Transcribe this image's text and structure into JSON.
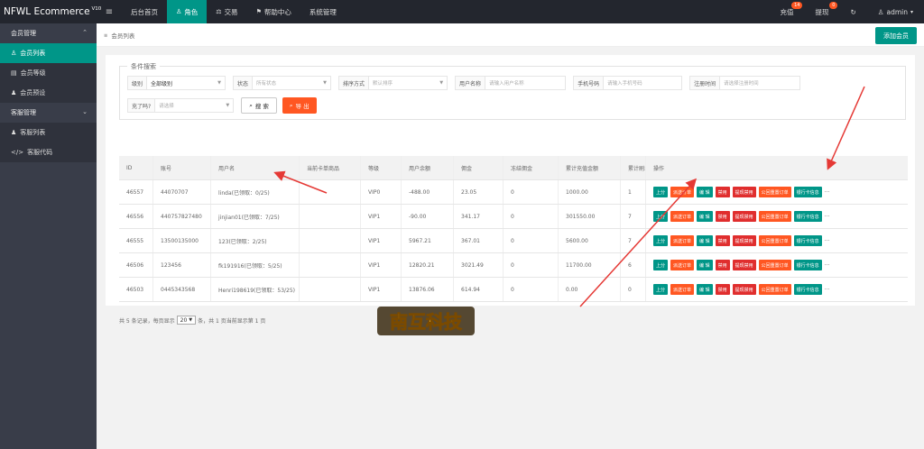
{
  "topbar": {
    "brand": "NFWL Ecommerce",
    "brand_version": "V10",
    "nav": [
      {
        "label": "后台首页",
        "icon": ""
      },
      {
        "label": "角色",
        "icon": "person-icon"
      },
      {
        "label": "交易",
        "icon": "scale-icon"
      },
      {
        "label": "帮助中心",
        "icon": "flag-icon"
      },
      {
        "label": "系统管理",
        "icon": ""
      }
    ],
    "recharge_label": "充值",
    "recharge_badge": "14",
    "withdraw_label": "提现",
    "withdraw_badge": "0",
    "user_label": "admin"
  },
  "sidebar": {
    "groups": [
      {
        "label": "会员管理",
        "items": [
          "会员列表",
          "会员等级",
          "会员预设"
        ]
      },
      {
        "label": "客服管理",
        "items": [
          "客服列表",
          "客服代码"
        ]
      }
    ]
  },
  "page": {
    "breadcrumb": "会员列表",
    "add_button": "添加会员"
  },
  "filters": {
    "legend": "条件搜索",
    "level_label": "级别",
    "level_value": "全部级别",
    "status_label": "状态",
    "status_placeholder": "所有状态",
    "sort_label": "排序方式",
    "sort_placeholder": "默认排序",
    "username_label": "用户名称",
    "username_placeholder": "请输入用户名称",
    "phone_label": "手机号码",
    "phone_placeholder": "请输入手机号码",
    "regtime_label": "注册时间",
    "regtime_placeholder": "请选择注册时间",
    "complete_label": "充了吗?",
    "complete_placeholder": "请选择",
    "search_button": "搜 索",
    "export_button": "导 出"
  },
  "table": {
    "headers": [
      "ID",
      "账号",
      "用户名",
      "当前卡单商品",
      "等级",
      "用户余额",
      "佣金",
      "冻结佣金",
      "累计充值金额",
      "累计刷单",
      "操作"
    ],
    "rows": [
      [
        "46557",
        "44070707",
        "linda(已领取：0/25)",
        "",
        "VIP0",
        "-488.00",
        "23.05",
        "0",
        "1000.00",
        "1"
      ],
      [
        "46556",
        "440757827480",
        "jinjian01(已领取：7/25)",
        "",
        "VIP1",
        "-90.00",
        "341.17",
        "0",
        "301550.00",
        "7"
      ],
      [
        "46555",
        "13500135000",
        "123(已领取：2/25)",
        "",
        "VIP1",
        "5967.21",
        "367.01",
        "0",
        "5600.00",
        "7"
      ],
      [
        "46506",
        "123456",
        "fk191916(已领取：5/25)",
        "",
        "VIP1",
        "12820.21",
        "3021.49",
        "0",
        "11700.00",
        "6"
      ],
      [
        "46503",
        "0445343568",
        "Henri198619(已领取：53/25)",
        "",
        "VIP1",
        "13876.06",
        "614.94",
        "0",
        "0.00",
        "0"
      ]
    ],
    "ops": [
      "上分",
      "派送订单",
      "编 辑",
      "禁用",
      "提现禁用",
      "公回重置订单",
      "银行卡信息"
    ],
    "more": "···"
  },
  "pager": {
    "prefix": "共 5 条记录，每页显示",
    "page_size": "20",
    "suffix": "条，共 1 页当前显示第 1 页"
  },
  "watermark_text": "南互科技",
  "colors": {
    "accent": "#009688",
    "orange": "#ff5722",
    "red": "#e02e2e",
    "dark": "#23262e",
    "sidebar": "#393d49"
  }
}
